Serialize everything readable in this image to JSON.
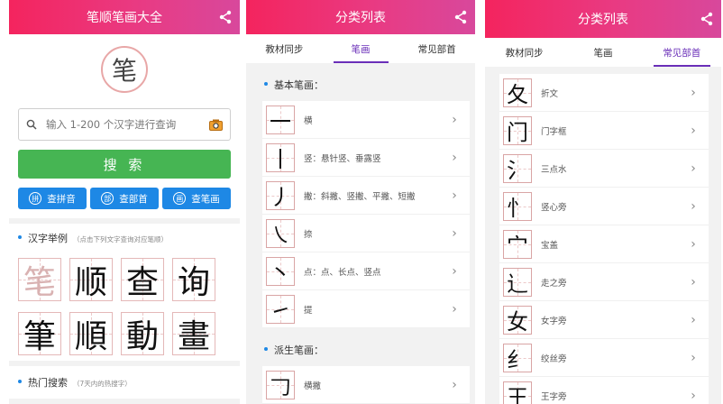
{
  "screen1": {
    "title": "笔顺笔画大全",
    "logo_char": "笔",
    "search_placeholder": "输入 1-200 个汉字进行查询",
    "search_button": "搜 索",
    "quick_buttons": [
      {
        "icon": "拼",
        "label": "查拼音"
      },
      {
        "icon": "部",
        "label": "查部首"
      },
      {
        "icon": "画",
        "label": "查笔画"
      }
    ],
    "examples_title": "汉字举例",
    "examples_hint": "（点击下列文字查询对应笔顺）",
    "example_chars": [
      "笔",
      "顺",
      "查",
      "询",
      "筆",
      "順",
      "動",
      "畫"
    ],
    "hot_title": "热门搜索",
    "hot_hint": "（7天内的热搜字）"
  },
  "screen2": {
    "title": "分类列表",
    "tabs": [
      "教材同步",
      "笔画",
      "常见部首"
    ],
    "active_tab": 1,
    "basic_title": "基本笔画：",
    "basic_items": [
      {
        "char": "一",
        "label": "横"
      },
      {
        "char": "丨",
        "label": "竖：悬针竖、垂露竖"
      },
      {
        "char": "丿",
        "label": "撇：斜撇、竖撇、平撇、短撇"
      },
      {
        "char": "㇏",
        "label": "捺"
      },
      {
        "char": "丶",
        "label": "点：点、长点、竖点"
      },
      {
        "char": "㇀",
        "label": "提"
      }
    ],
    "derived_title": "派生笔画：",
    "derived_items": [
      {
        "char": "𠃌",
        "label": "横撇"
      }
    ]
  },
  "screen3": {
    "title": "分类列表",
    "tabs": [
      "教材同步",
      "笔画",
      "常见部首"
    ],
    "active_tab": 2,
    "items": [
      {
        "char": "夂",
        "label": "折文"
      },
      {
        "char": "门",
        "label": "门字框"
      },
      {
        "char": "氵",
        "label": "三点水"
      },
      {
        "char": "忄",
        "label": "竖心旁"
      },
      {
        "char": "宀",
        "label": "宝盖"
      },
      {
        "char": "辶",
        "label": "走之旁"
      },
      {
        "char": "女",
        "label": "女字旁"
      },
      {
        "char": "纟",
        "label": "绞丝旁"
      },
      {
        "char": "王",
        "label": "王字旁"
      }
    ]
  },
  "colors": {
    "header_start": "#f4245e",
    "header_end": "#d8489c",
    "search_green": "#46b553",
    "button_blue": "#1e88e5",
    "tab_active": "#6a2fb8"
  },
  "icons": {
    "share": "share-icon",
    "search": "search-icon",
    "camera": "camera-icon",
    "chevron": "chevron-right-icon"
  }
}
